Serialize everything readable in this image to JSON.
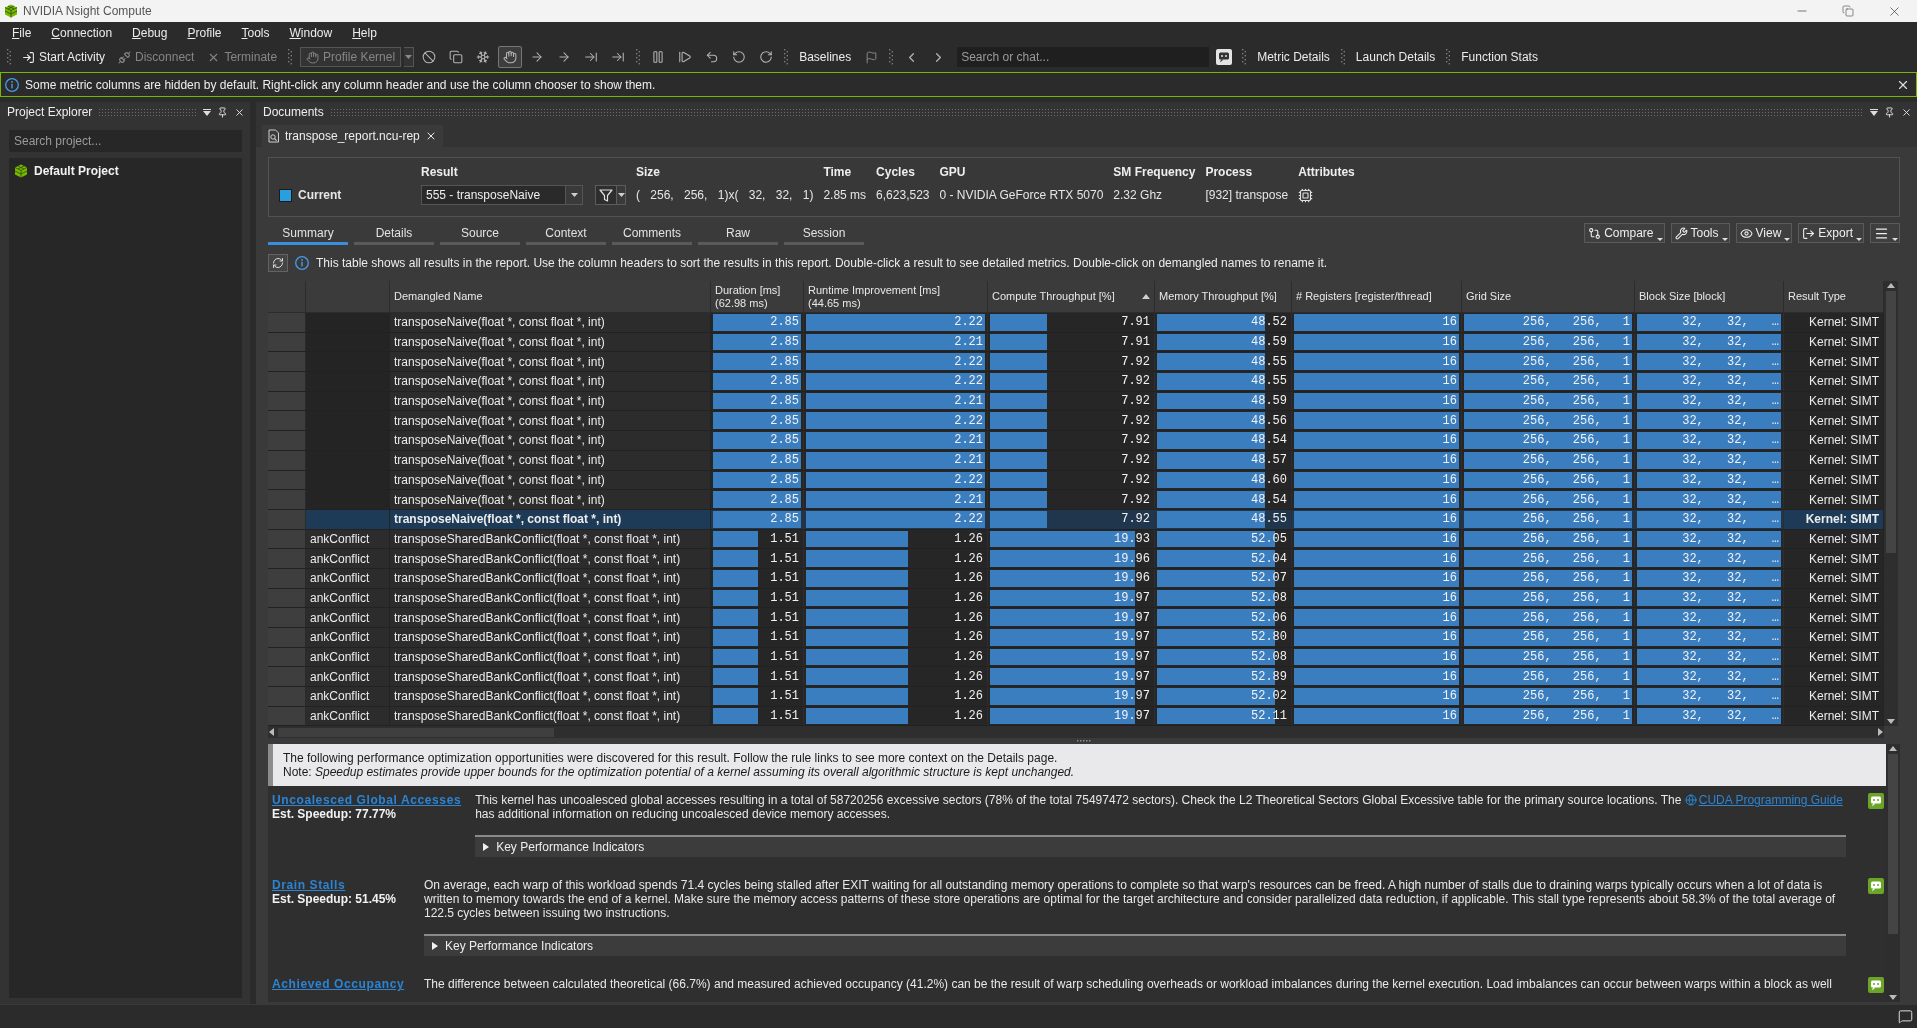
{
  "window": {
    "title": "NVIDIA Nsight Compute"
  },
  "menu": [
    "File",
    "Connection",
    "Debug",
    "Profile",
    "Tools",
    "Window",
    "Help"
  ],
  "toolbar": {
    "actions": [
      {
        "label": "Start Activity",
        "disabled": false
      },
      {
        "label": "Disconnect",
        "disabled": true
      },
      {
        "label": "Terminate",
        "disabled": true
      }
    ],
    "profile_kernel": {
      "label": "Profile Kernel",
      "disabled": true
    },
    "toggle_button": {
      "pressed": true
    },
    "baselines": "Baselines",
    "search": {
      "placeholder": "Search or chat..."
    },
    "panels": [
      "Metric Details",
      "Launch Details",
      "Function Stats"
    ]
  },
  "notice": "Some metric columns are hidden by default. Right-click any column header and use the column chooser to show them.",
  "project_explorer": {
    "title": "Project Explorer",
    "search": {
      "placeholder": "Search project..."
    },
    "items": [
      {
        "label": "Default Project"
      }
    ]
  },
  "documents": {
    "title": "Documents",
    "tabs": [
      {
        "label": "transpose_report.ncu-rep",
        "selected": true
      }
    ]
  },
  "result_header": {
    "baseline": "Current",
    "result_label": "Result",
    "result_value": "555 - transposeNaive",
    "fields": [
      {
        "label": "Size",
        "value": "( 256, 256, 1)x( 32, 32, 1)"
      },
      {
        "label": "Time",
        "value": "2.85 ms"
      },
      {
        "label": "Cycles",
        "value": "6,623,523"
      },
      {
        "label": "GPU",
        "value": "0 - NVIDIA GeForce RTX 5070"
      },
      {
        "label": "SM Frequency",
        "value": "2.32 Ghz"
      },
      {
        "label": "Process",
        "value": "[932] transpose"
      }
    ],
    "attributes_label": "Attributes"
  },
  "view_tabs": [
    {
      "label": "Summary",
      "selected": true
    },
    {
      "label": "Details",
      "selected": false
    },
    {
      "label": "Source",
      "selected": false
    },
    {
      "label": "Context",
      "selected": false
    },
    {
      "label": "Comments",
      "selected": false
    },
    {
      "label": "Raw",
      "selected": false
    },
    {
      "label": "Session",
      "selected": false
    }
  ],
  "view_actions": [
    "Compare",
    "Tools",
    "View",
    "Export"
  ],
  "table_hint": "This table shows all results in the report. Use the column headers to sort the results in this report. Double-click a result to see detailed metrics. Double-click on demangled names to rename it.",
  "table": {
    "columns": [
      {
        "label": "Demangled Name",
        "sorted": false
      },
      {
        "label": "Duration [ms]",
        "subtitle": "(62.98 ms)",
        "sorted": false
      },
      {
        "label": "Runtime Improvement [ms]",
        "subtitle": "(44.65 ms)",
        "sorted": false
      },
      {
        "label": "Compute Throughput [%]",
        "sorted": true
      },
      {
        "label": "Memory Throughput [%]",
        "sorted": false
      },
      {
        "label": "# Registers [register/thread]",
        "sorted": false
      },
      {
        "label": "Grid Size",
        "sorted": false
      },
      {
        "label": "Block Size [block]",
        "sorted": false
      },
      {
        "label": "Result Type",
        "sorted": false
      }
    ],
    "rows": [
      {
        "selected": false,
        "name": "transposeNaive(float *, const float *, int)",
        "metrics": [
          {
            "text": "2.85",
            "level": 1
          },
          {
            "text": "2.22",
            "level": 1
          },
          {
            "text": "7.91",
            "level": 0.37
          },
          {
            "text": "48.52",
            "level": 0.82
          },
          {
            "text": "16",
            "level": 1
          },
          {
            "text": "256, 256, 1",
            "level": 1
          },
          {
            "text": "32, 32, …",
            "level": 1
          }
        ],
        "result_type": "Kernel: SIMT"
      },
      {
        "selected": false,
        "name": "transposeNaive(float *, const float *, int)",
        "metrics": [
          {
            "text": "2.85",
            "level": 1
          },
          {
            "text": "2.21",
            "level": 1
          },
          {
            "text": "7.91",
            "level": 0.37
          },
          {
            "text": "48.59",
            "level": 0.82
          },
          {
            "text": "16",
            "level": 1
          },
          {
            "text": "256, 256, 1",
            "level": 1
          },
          {
            "text": "32, 32, …",
            "level": 1
          }
        ],
        "result_type": "Kernel: SIMT"
      },
      {
        "selected": false,
        "name": "transposeNaive(float *, const float *, int)",
        "metrics": [
          {
            "text": "2.85",
            "level": 1
          },
          {
            "text": "2.22",
            "level": 1
          },
          {
            "text": "7.92",
            "level": 0.37
          },
          {
            "text": "48.55",
            "level": 0.82
          },
          {
            "text": "16",
            "level": 1
          },
          {
            "text": "256, 256, 1",
            "level": 1
          },
          {
            "text": "32, 32, …",
            "level": 1
          }
        ],
        "result_type": "Kernel: SIMT"
      },
      {
        "selected": false,
        "name": "transposeNaive(float *, const float *, int)",
        "metrics": [
          {
            "text": "2.85",
            "level": 1
          },
          {
            "text": "2.22",
            "level": 1
          },
          {
            "text": "7.92",
            "level": 0.37
          },
          {
            "text": "48.55",
            "level": 0.82
          },
          {
            "text": "16",
            "level": 1
          },
          {
            "text": "256, 256, 1",
            "level": 1
          },
          {
            "text": "32, 32, …",
            "level": 1
          }
        ],
        "result_type": "Kernel: SIMT"
      },
      {
        "selected": false,
        "name": "transposeNaive(float *, const float *, int)",
        "metrics": [
          {
            "text": "2.85",
            "level": 1
          },
          {
            "text": "2.21",
            "level": 1
          },
          {
            "text": "7.92",
            "level": 0.37
          },
          {
            "text": "48.59",
            "level": 0.82
          },
          {
            "text": "16",
            "level": 1
          },
          {
            "text": "256, 256, 1",
            "level": 1
          },
          {
            "text": "32, 32, …",
            "level": 1
          }
        ],
        "result_type": "Kernel: SIMT"
      },
      {
        "selected": false,
        "name": "transposeNaive(float *, const float *, int)",
        "metrics": [
          {
            "text": "2.85",
            "level": 1
          },
          {
            "text": "2.22",
            "level": 1
          },
          {
            "text": "7.92",
            "level": 0.37
          },
          {
            "text": "48.56",
            "level": 0.82
          },
          {
            "text": "16",
            "level": 1
          },
          {
            "text": "256, 256, 1",
            "level": 1
          },
          {
            "text": "32, 32, …",
            "level": 1
          }
        ],
        "result_type": "Kernel: SIMT"
      },
      {
        "selected": false,
        "name": "transposeNaive(float *, const float *, int)",
        "metrics": [
          {
            "text": "2.85",
            "level": 1
          },
          {
            "text": "2.21",
            "level": 1
          },
          {
            "text": "7.92",
            "level": 0.37
          },
          {
            "text": "48.54",
            "level": 0.82
          },
          {
            "text": "16",
            "level": 1
          },
          {
            "text": "256, 256, 1",
            "level": 1
          },
          {
            "text": "32, 32, …",
            "level": 1
          }
        ],
        "result_type": "Kernel: SIMT"
      },
      {
        "selected": false,
        "name": "transposeNaive(float *, const float *, int)",
        "metrics": [
          {
            "text": "2.85",
            "level": 1
          },
          {
            "text": "2.21",
            "level": 1
          },
          {
            "text": "7.92",
            "level": 0.37
          },
          {
            "text": "48.57",
            "level": 0.82
          },
          {
            "text": "16",
            "level": 1
          },
          {
            "text": "256, 256, 1",
            "level": 1
          },
          {
            "text": "32, 32, …",
            "level": 1
          }
        ],
        "result_type": "Kernel: SIMT"
      },
      {
        "selected": false,
        "name": "transposeNaive(float *, const float *, int)",
        "metrics": [
          {
            "text": "2.85",
            "level": 1
          },
          {
            "text": "2.22",
            "level": 1
          },
          {
            "text": "7.92",
            "level": 0.37
          },
          {
            "text": "48.60",
            "level": 0.82
          },
          {
            "text": "16",
            "level": 1
          },
          {
            "text": "256, 256, 1",
            "level": 1
          },
          {
            "text": "32, 32, …",
            "level": 1
          }
        ],
        "result_type": "Kernel: SIMT"
      },
      {
        "selected": false,
        "name": "transposeNaive(float *, const float *, int)",
        "metrics": [
          {
            "text": "2.85",
            "level": 1
          },
          {
            "text": "2.21",
            "level": 1
          },
          {
            "text": "7.92",
            "level": 0.37
          },
          {
            "text": "48.54",
            "level": 0.82
          },
          {
            "text": "16",
            "level": 1
          },
          {
            "text": "256, 256, 1",
            "level": 1
          },
          {
            "text": "32, 32, …",
            "level": 1
          }
        ],
        "result_type": "Kernel: SIMT"
      },
      {
        "selected": true,
        "name": "transposeNaive(float *, const float *, int)",
        "metrics": [
          {
            "text": "2.85",
            "level": 1
          },
          {
            "text": "2.22",
            "level": 1
          },
          {
            "text": "7.92",
            "level": 0.37
          },
          {
            "text": "48.55",
            "level": 0.82
          },
          {
            "text": "16",
            "level": 1
          },
          {
            "text": "256, 256, 1",
            "level": 1
          },
          {
            "text": "32, 32, …",
            "level": 1
          }
        ],
        "result_type": "Kernel: SIMT"
      },
      {
        "selected": false,
        "column_2": "ankConflict",
        "name": "transposeSharedBankConflict(float *, const float *, int)",
        "metrics": [
          {
            "text": "1.51",
            "level": 0.53
          },
          {
            "text": "1.26",
            "level": 0.58
          },
          {
            "text": "19.93",
            "level": 0.9
          },
          {
            "text": "52.05",
            "level": 0.9
          },
          {
            "text": "16",
            "level": 1
          },
          {
            "text": "256, 256, 1",
            "level": 1
          },
          {
            "text": "32, 32, …",
            "level": 1
          }
        ],
        "result_type": "Kernel: SIMT"
      },
      {
        "selected": false,
        "column_2": "ankConflict",
        "name": "transposeSharedBankConflict(float *, const float *, int)",
        "metrics": [
          {
            "text": "1.51",
            "level": 0.53
          },
          {
            "text": "1.26",
            "level": 0.58
          },
          {
            "text": "19.96",
            "level": 0.9
          },
          {
            "text": "52.04",
            "level": 0.9
          },
          {
            "text": "16",
            "level": 1
          },
          {
            "text": "256, 256, 1",
            "level": 1
          },
          {
            "text": "32, 32, …",
            "level": 1
          }
        ],
        "result_type": "Kernel: SIMT"
      },
      {
        "selected": false,
        "column_2": "ankConflict",
        "name": "transposeSharedBankConflict(float *, const float *, int)",
        "metrics": [
          {
            "text": "1.51",
            "level": 0.53
          },
          {
            "text": "1.26",
            "level": 0.58
          },
          {
            "text": "19.96",
            "level": 0.9
          },
          {
            "text": "52.07",
            "level": 0.9
          },
          {
            "text": "16",
            "level": 1
          },
          {
            "text": "256, 256, 1",
            "level": 1
          },
          {
            "text": "32, 32, …",
            "level": 1
          }
        ],
        "result_type": "Kernel: SIMT"
      },
      {
        "selected": false,
        "column_2": "ankConflict",
        "name": "transposeSharedBankConflict(float *, const float *, int)",
        "metrics": [
          {
            "text": "1.51",
            "level": 0.53
          },
          {
            "text": "1.26",
            "level": 0.58
          },
          {
            "text": "19.97",
            "level": 0.9
          },
          {
            "text": "52.08",
            "level": 0.9
          },
          {
            "text": "16",
            "level": 1
          },
          {
            "text": "256, 256, 1",
            "level": 1
          },
          {
            "text": "32, 32, …",
            "level": 1
          }
        ],
        "result_type": "Kernel: SIMT"
      },
      {
        "selected": false,
        "column_2": "ankConflict",
        "name": "transposeSharedBankConflict(float *, const float *, int)",
        "metrics": [
          {
            "text": "1.51",
            "level": 0.53
          },
          {
            "text": "1.26",
            "level": 0.58
          },
          {
            "text": "19.97",
            "level": 0.9
          },
          {
            "text": "52.06",
            "level": 0.9
          },
          {
            "text": "16",
            "level": 1
          },
          {
            "text": "256, 256, 1",
            "level": 1
          },
          {
            "text": "32, 32, …",
            "level": 1
          }
        ],
        "result_type": "Kernel: SIMT"
      },
      {
        "selected": false,
        "column_2": "ankConflict",
        "name": "transposeSharedBankConflict(float *, const float *, int)",
        "metrics": [
          {
            "text": "1.51",
            "level": 0.53
          },
          {
            "text": "1.26",
            "level": 0.58
          },
          {
            "text": "19.97",
            "level": 0.9
          },
          {
            "text": "52.80",
            "level": 0.9
          },
          {
            "text": "16",
            "level": 1
          },
          {
            "text": "256, 256, 1",
            "level": 1
          },
          {
            "text": "32, 32, …",
            "level": 1
          }
        ],
        "result_type": "Kernel: SIMT"
      },
      {
        "selected": false,
        "column_2": "ankConflict",
        "name": "transposeSharedBankConflict(float *, const float *, int)",
        "metrics": [
          {
            "text": "1.51",
            "level": 0.53
          },
          {
            "text": "1.26",
            "level": 0.58
          },
          {
            "text": "19.97",
            "level": 0.9
          },
          {
            "text": "52.08",
            "level": 0.9
          },
          {
            "text": "16",
            "level": 1
          },
          {
            "text": "256, 256, 1",
            "level": 1
          },
          {
            "text": "32, 32, …",
            "level": 1
          }
        ],
        "result_type": "Kernel: SIMT"
      },
      {
        "selected": false,
        "column_2": "ankConflict",
        "name": "transposeSharedBankConflict(float *, const float *, int)",
        "metrics": [
          {
            "text": "1.51",
            "level": 0.53
          },
          {
            "text": "1.26",
            "level": 0.58
          },
          {
            "text": "19.97",
            "level": 0.9
          },
          {
            "text": "52.89",
            "level": 0.9
          },
          {
            "text": "16",
            "level": 1
          },
          {
            "text": "256, 256, 1",
            "level": 1
          },
          {
            "text": "32, 32, …",
            "level": 1
          }
        ],
        "result_type": "Kernel: SIMT"
      },
      {
        "selected": false,
        "column_2": "ankConflict",
        "name": "transposeSharedBankConflict(float *, const float *, int)",
        "metrics": [
          {
            "text": "1.51",
            "level": 0.53
          },
          {
            "text": "1.26",
            "level": 0.58
          },
          {
            "text": "19.97",
            "level": 0.9
          },
          {
            "text": "52.02",
            "level": 0.9
          },
          {
            "text": "16",
            "level": 1
          },
          {
            "text": "256, 256, 1",
            "level": 1
          },
          {
            "text": "32, 32, …",
            "level": 1
          }
        ],
        "result_type": "Kernel: SIMT"
      },
      {
        "selected": false,
        "column_2": "ankConflict",
        "name": "transposeSharedBankConflict(float *, const float *, int)",
        "metrics": [
          {
            "text": "1.51",
            "level": 0.53
          },
          {
            "text": "1.26",
            "level": 0.58
          },
          {
            "text": "19.97",
            "level": 0.9
          },
          {
            "text": "52.11",
            "level": 0.9
          },
          {
            "text": "16",
            "level": 1
          },
          {
            "text": "256, 256, 1",
            "level": 1
          },
          {
            "text": "32, 32, …",
            "level": 1
          }
        ],
        "result_type": "Kernel: SIMT"
      }
    ]
  },
  "rules_intro": {
    "text": "The following performance optimization opportunities were discovered for this result. Follow the rule links to see more context on the Details page.",
    "note": "Note: *Speedup estimates provide upper bounds for the optimization potential of a kernel assuming its overall algorithmic structure is kept unchanged.*"
  },
  "rules": [
    {
      "title": "Uncoalesced Global Accesses",
      "speedup": "Est. Speedup: 77.77%",
      "text_before": "This kernel has uncoalesced global accesses resulting in a total of 58720256 excessive sectors (78% of the total 75497472 sectors). Check the L2 Theoretical Sectors Global Excessive table for the primary source locations. The",
      "link": "CUDA Programming Guide",
      "text_after": "has additional information on reducing uncoalesced device memory accesses.",
      "kpi": {
        "label": "Key Performance Indicators",
        "expanded": false
      }
    },
    {
      "title": "Drain Stalls",
      "speedup": "Est. Speedup: 51.45%",
      "text_before": "On average, each warp of this workload spends 71.4 cycles being stalled after EXIT waiting for all outstanding memory operations to complete so that warp's resources can be freed. A high number of stalls due to draining warps typically occurs when a lot of data is written to memory towards the end of a kernel. Make sure the memory access patterns of these store operations are optimal for the target architecture and consider parallelized data reduction, if applicable. This stall type represents about 58.3% of the total average of 122.5 cycles between issuing two instructions.",
      "kpi": {
        "label": "Key Performance Indicators",
        "expanded": false
      }
    },
    {
      "title": "Achieved Occupancy",
      "text_before": "The difference between calculated theoretical (66.7%) and measured achieved occupancy (41.2%) can be the result of warp scheduling overheads or workload imbalances during the kernel execution. Load imbalances can occur between warps within a block as well"
    }
  ]
}
